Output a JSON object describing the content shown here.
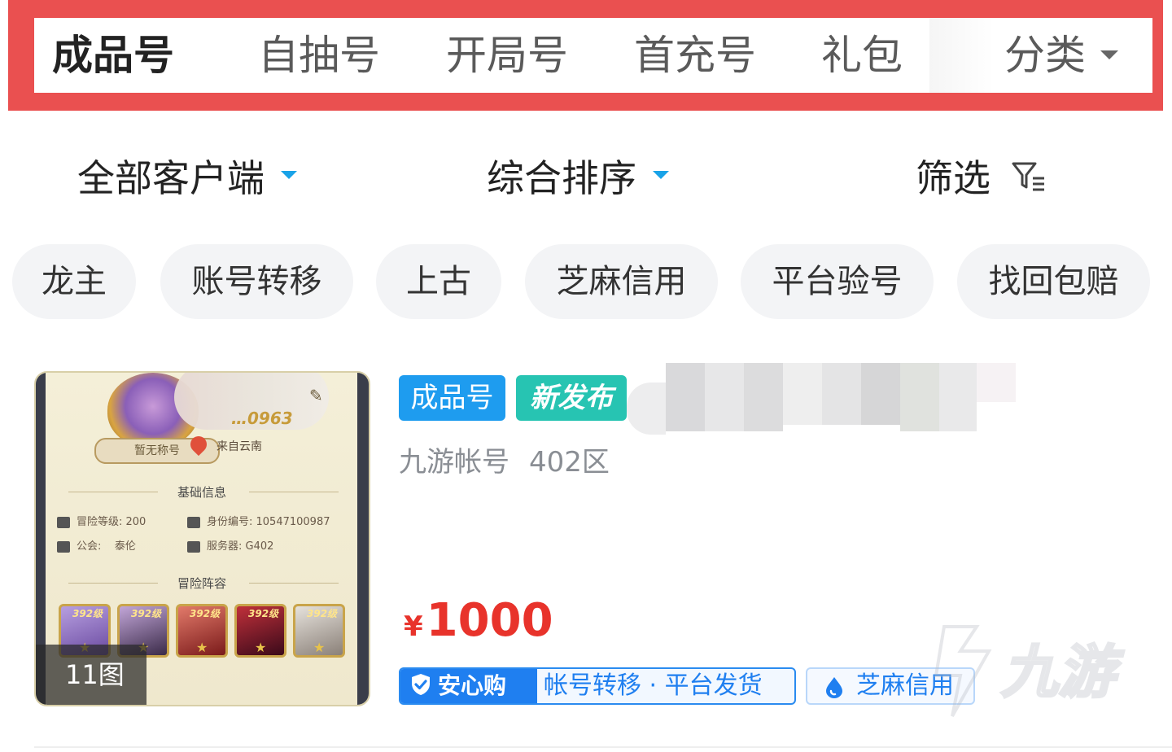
{
  "tabs": [
    "成品号",
    "自抽号",
    "开局号",
    "首充号",
    "礼包",
    "分类"
  ],
  "filters": {
    "client": "全部客户端",
    "sort": "综合排序",
    "screen": "筛选"
  },
  "chips": [
    "龙主",
    "账号转移",
    "上古",
    "芝麻信用",
    "平台验号",
    "找回包赔"
  ],
  "listing": {
    "tags": [
      "成品号",
      "新发布"
    ],
    "source": "九游帐号",
    "server": "402区",
    "price_symbol": "¥",
    "price": "1000",
    "image_count": "11图",
    "guarantee_badge": "安心购",
    "guarantee_text": "帐号转移 · 平台发货",
    "credit_badge": "芝麻信用",
    "screenshot": {
      "title_badge": "暂无称号",
      "id_partial": "…0963",
      "location": "来自云南",
      "section_basic": "基础信息",
      "adventure_level": "冒险等级: 200",
      "identity_no": "身份编号: 10547100987",
      "guild": "公会:",
      "guild_name": "泰伦",
      "server": "服务器: G402",
      "section_lineup": "冒险阵容",
      "hero_level": "392级"
    }
  },
  "watermark": "九游",
  "colors": {
    "highlight_frame": "#ea5050",
    "accent_blue": "#1e9cef",
    "new_tag": "#27c4b2",
    "price": "#e8332b",
    "chip_bg": "#f3f4f6"
  }
}
